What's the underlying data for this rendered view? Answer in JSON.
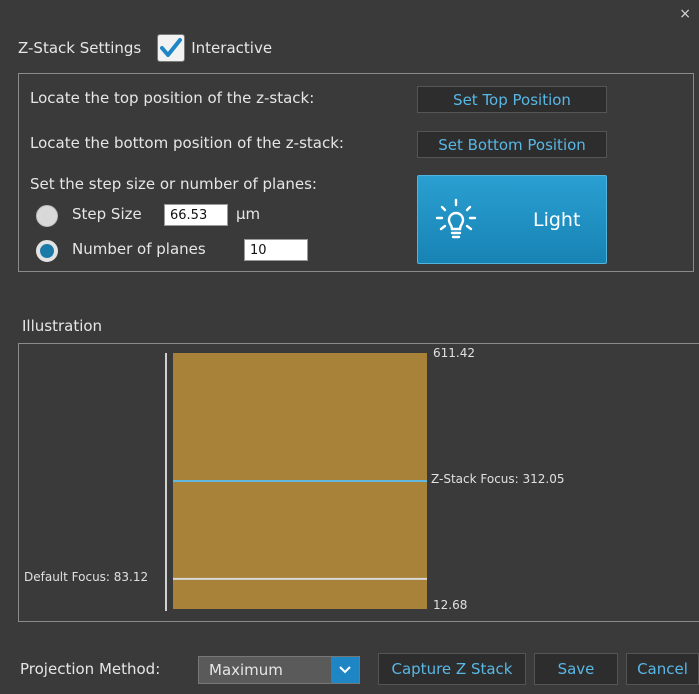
{
  "window": {
    "close_glyph": "×"
  },
  "header": {
    "title": "Z-Stack Settings",
    "interactive_label": "Interactive",
    "interactive_checked": true
  },
  "locate": {
    "top_label": "Locate the top position of the z-stack:",
    "top_button": "Set Top Position",
    "bottom_label": "Locate the bottom position of the z-stack:",
    "bottom_button": "Set Bottom Position",
    "step_prompt": "Set the step size or number of planes:",
    "step_size_label": "Step Size",
    "step_size_value": "66.53",
    "step_size_unit": "µm",
    "planes_label": "Number of planes",
    "planes_value": "10",
    "selected_mode": "Number of planes"
  },
  "light_button": {
    "label": "Light",
    "icon": "lightbulb-icon"
  },
  "illustration": {
    "title": "Illustration",
    "top_value": "611.42",
    "bottom_value": "12.68",
    "zstack_focus_label": "Z-Stack Focus: 312.05",
    "default_focus_label": "Default Focus: 83.12",
    "zstack_focus": 312.05,
    "default_focus": 83.12,
    "range_max": 611.42,
    "range_min": 12.68,
    "colors": {
      "stack": "#a9823a",
      "zstack_line": "#63b8dd",
      "default_line": "#d8d8d8"
    }
  },
  "footer": {
    "projection_label": "Projection Method:",
    "projection_value": "Maximum",
    "capture_button": "Capture Z Stack",
    "save_button": "Save",
    "cancel_button": "Cancel"
  }
}
